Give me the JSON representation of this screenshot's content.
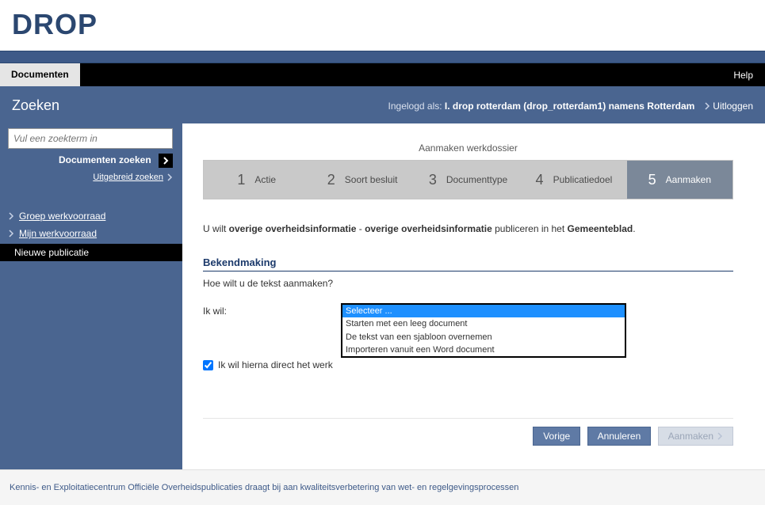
{
  "logo": "DROP",
  "nav": {
    "documenten": "Documenten",
    "help": "Help"
  },
  "subheader": {
    "zoeken": "Zoeken",
    "login_prefix": "Ingelogd als: ",
    "login_user": "I. drop rotterdam (drop_rotterdam1) namens Rotterdam",
    "logout": "Uitloggen"
  },
  "sidebar": {
    "placeholder": "Vul een zoekterm in",
    "doc_zoeken": "Documenten zoeken",
    "uitgebreid": "Uitgebreid zoeken",
    "groep": "Groep werkvoorraad",
    "mijn": "Mijn werkvoorraad",
    "nieuwe": "Nieuwe publicatie"
  },
  "wizard": {
    "title": "Aanmaken werkdossier",
    "steps": {
      "s1": "Actie",
      "s2": "Soort besluit",
      "s3": "Documenttype",
      "s4": "Publicatiedoel",
      "s5": "Aanmaken"
    }
  },
  "intro": {
    "p1": "U wilt ",
    "b1": "overige overheidsinformatie",
    "p2": " - ",
    "b2": "overige overheidsinformatie",
    "p3": " publiceren in het ",
    "b3": "Gemeenteblad",
    "p4": "."
  },
  "section": {
    "title": "Bekendmaking",
    "question": "Hoe wilt u de tekst aanmaken?",
    "label": "Ik wil:",
    "options": {
      "o1": "Selecteer ...",
      "o2": "Starten met een leeg document",
      "o3": "De tekst van een sjabloon overnemen",
      "o4": "Importeren vanuit een Word document"
    },
    "checkbox": "Ik wil hierna direct het werk"
  },
  "buttons": {
    "vorige": "Vorige",
    "annuleren": "Annuleren",
    "aanmaken": "Aanmaken"
  },
  "footer": "Kennis- en Exploitatiecentrum Officiële Overheidspublicaties draagt bij aan kwaliteitsverbetering van wet- en regelgevingsprocessen"
}
